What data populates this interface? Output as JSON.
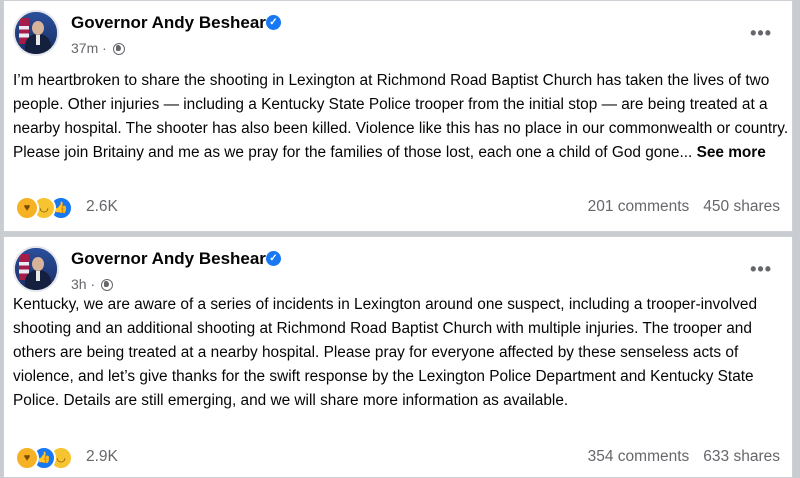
{
  "posts": [
    {
      "author": "Governor Andy Beshear",
      "time": "37m",
      "separator": "·",
      "body": "I’m heartbroken to share the shooting in Lexington at Richmond Road Baptist Church has taken the lives of two people. Other injuries — including a Kentucky State Police trooper from the initial stop — are being treated at a nearby hospital. The shooter has also been killed. Violence like this has no place in our commonwealth or country. Please join Britainy and me as we pray for the families of those lost, each one a child of God gone...",
      "see_more": "See more",
      "reactions": [
        "care",
        "sad",
        "like"
      ],
      "reaction_count": "2.6K",
      "comments": "201 comments",
      "shares": "450 shares"
    },
    {
      "author": "Governor Andy Beshear",
      "time": "3h",
      "separator": "·",
      "body": "Kentucky, we are aware of a series of incidents in Lexington around one suspect, including a trooper-involved shooting and an additional shooting at Richmond Road Baptist Church with multiple injuries. The trooper and others are being treated at a nearby hospital. Please pray for everyone affected by these senseless acts of violence, and let’s give thanks for the swift response by the Lexington Police Department and Kentucky State Police. Details are still emerging, and we will share more information as available.",
      "reactions": [
        "care",
        "like",
        "sad"
      ],
      "reaction_count": "2.9K",
      "comments": "354 comments",
      "shares": "633 shares"
    }
  ],
  "ui": {
    "more_menu_glyph": "•••",
    "verified_glyph": "✓"
  },
  "colors": {
    "verified": "#1877f2",
    "secondary_text": "#65676b",
    "feed_background": "#c9ccd1"
  }
}
